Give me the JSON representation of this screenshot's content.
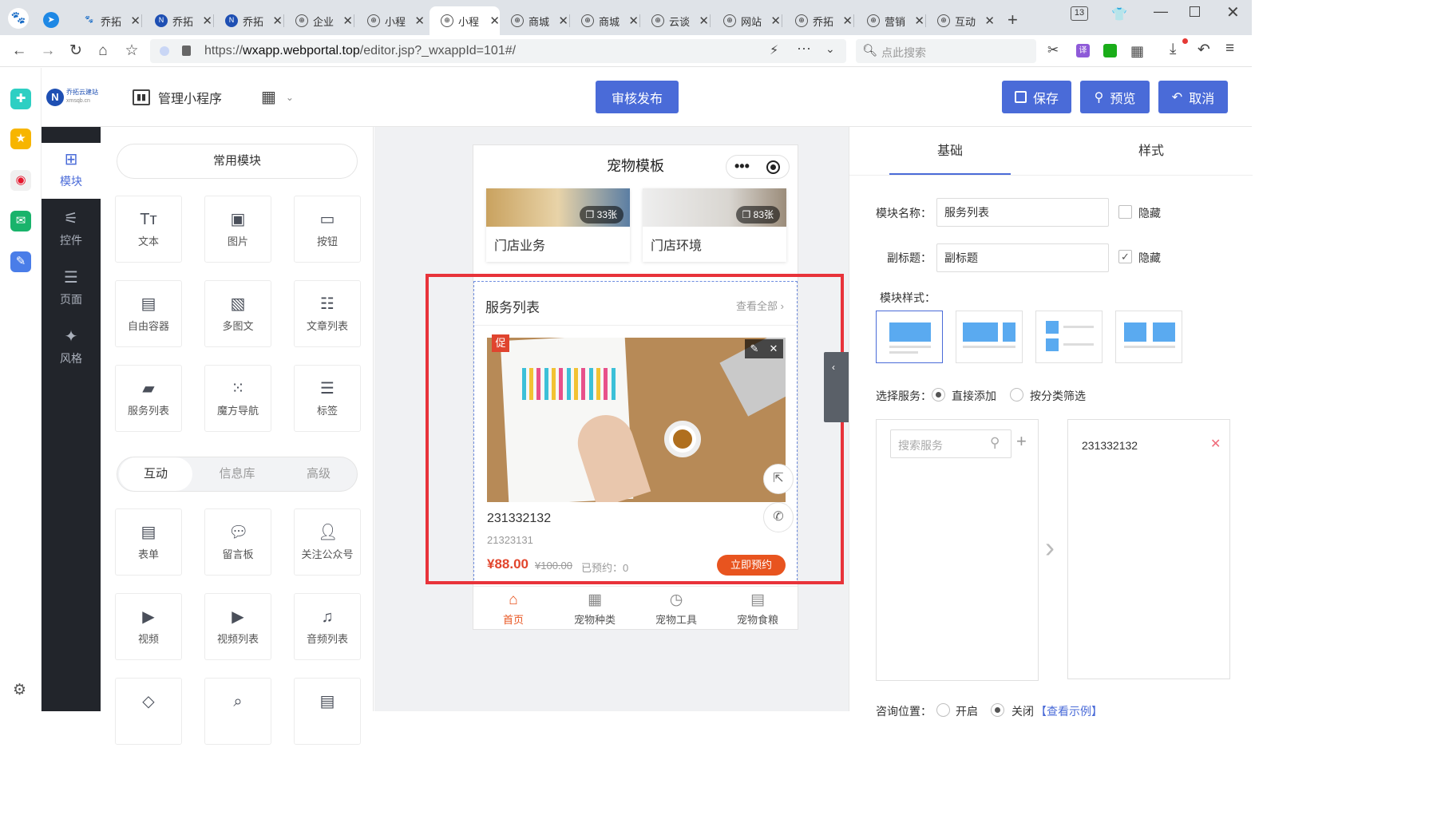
{
  "browser": {
    "tabs": [
      {
        "label": "乔拓",
        "icon": "paw-icon"
      },
      {
        "label": "乔拓",
        "icon": "n-logo-icon"
      },
      {
        "label": "乔拓",
        "icon": "n-logo-icon"
      },
      {
        "label": "企业",
        "icon": "globe-icon"
      },
      {
        "label": "小程",
        "icon": "globe-icon"
      },
      {
        "label": "小程",
        "icon": "globe-icon",
        "active": true
      },
      {
        "label": "商城",
        "icon": "globe-icon"
      },
      {
        "label": "商城",
        "icon": "globe-icon"
      },
      {
        "label": "云谈",
        "icon": "globe-icon"
      },
      {
        "label": "网站",
        "icon": "globe-icon"
      },
      {
        "label": "乔拓",
        "icon": "globe-icon"
      },
      {
        "label": "营销",
        "icon": "globe-icon"
      },
      {
        "label": "互动",
        "icon": "globe-icon"
      }
    ],
    "tab_count": "13",
    "url_prefix": "https://",
    "url_host": "wxapp.webportal.top",
    "url_path": "/editor.jsp?_wxappId=101#/",
    "search_placeholder": "点此搜索"
  },
  "header": {
    "logo_name": "乔拓云建站",
    "logo_domain": "xmsqb.cn",
    "manage_label": "管理小程序",
    "publish_label": "审核发布",
    "save_label": "保存",
    "preview_label": "预览",
    "cancel_label": "取消"
  },
  "sidenav": [
    {
      "label": "模块",
      "icon": "plus-square-icon",
      "active": true
    },
    {
      "label": "控件",
      "icon": "sliders-icon"
    },
    {
      "label": "页面",
      "icon": "layers-icon"
    },
    {
      "label": "风格",
      "icon": "magic-wand-icon"
    }
  ],
  "modules": {
    "common_title": "常用模块",
    "common": [
      {
        "label": "文本",
        "icon": "text-icon"
      },
      {
        "label": "图片",
        "icon": "image-icon"
      },
      {
        "label": "按钮",
        "icon": "button-icon"
      },
      {
        "label": "自由容器",
        "icon": "container-icon"
      },
      {
        "label": "多图文",
        "icon": "gallery-icon"
      },
      {
        "label": "文章列表",
        "icon": "article-list-icon"
      },
      {
        "label": "服务列表",
        "icon": "service-list-icon"
      },
      {
        "label": "魔方导航",
        "icon": "cube-nav-icon"
      },
      {
        "label": "标签",
        "icon": "tag-icon"
      }
    ],
    "subtabs": [
      "互动",
      "信息库",
      "高级"
    ],
    "interactive": [
      {
        "label": "表单",
        "icon": "form-icon"
      },
      {
        "label": "留言板",
        "icon": "message-board-icon"
      },
      {
        "label": "关注公众号",
        "icon": "follow-user-icon"
      },
      {
        "label": "视频",
        "icon": "video-icon"
      },
      {
        "label": "视频列表",
        "icon": "video-list-icon"
      },
      {
        "label": "音频列表",
        "icon": "audio-list-icon"
      },
      {
        "label": "",
        "icon": "eraser-icon"
      },
      {
        "label": "",
        "icon": "search-doc-icon"
      },
      {
        "label": "",
        "icon": "card-icon"
      }
    ]
  },
  "phone": {
    "title": "宠物模板",
    "gallery": [
      {
        "caption": "门店业务",
        "count": "33张"
      },
      {
        "caption": "门店环境",
        "count": "83张"
      }
    ],
    "service": {
      "module_title": "服务列表",
      "view_all": "查看全部",
      "promo": "促",
      "name": "231332132",
      "subtitle": "21323131",
      "price": "¥88.00",
      "original_price": "¥100.00",
      "booked": "已预约：0",
      "book_button": "立即预约"
    },
    "tabbar": [
      {
        "label": "首页",
        "icon": "home-icon",
        "active": true
      },
      {
        "label": "宠物种类",
        "icon": "grid-icon"
      },
      {
        "label": "宠物工具",
        "icon": "clock-icon"
      },
      {
        "label": "宠物食粮",
        "icon": "document-icon"
      }
    ]
  },
  "settings": {
    "tabs": [
      "基础",
      "样式"
    ],
    "name_label": "模块名称：",
    "name_value": "服务列表",
    "hide_label": "隐藏",
    "subtitle_label": "副标题：",
    "subtitle_value": "副标题",
    "subtitle_hide_label": "隐藏",
    "style_label": "模块样式：",
    "choose_label": "选择服务：",
    "option_direct": "直接添加",
    "option_category": "按分类筛选",
    "search_placeholder": "搜索服务",
    "selected_item": "231332132",
    "bottom_label": "咨询位置：",
    "bottom_on": "开启",
    "bottom_off": "关闭",
    "bottom_link": "【查看示例】"
  }
}
